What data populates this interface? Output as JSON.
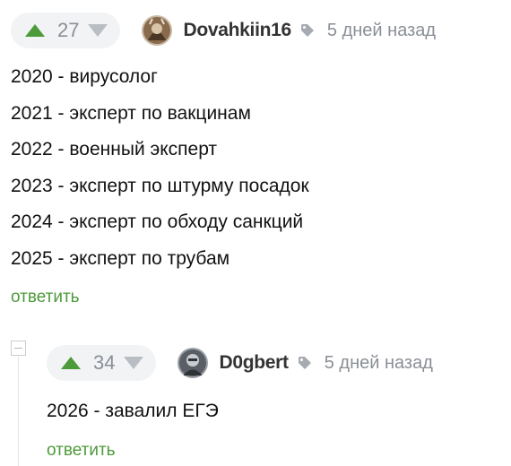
{
  "comments": [
    {
      "votes": "27",
      "username": "Dovahkiin16",
      "time": "5 дней назад",
      "lines": [
        "2020 - вирусолог",
        "2021 - эксперт по вакцинам",
        "2022 - военный эксперт",
        "2023 - эксперт по штурму посадок",
        "2024 - эксперт по обходу санкций",
        "2025 - эксперт по трубам"
      ],
      "reply_label": "ответить"
    },
    {
      "votes": "34",
      "username": "D0gbert",
      "time": "5 дней назад",
      "lines": [
        "2026 - завалил ЕГЭ"
      ],
      "reply_label": "ответить"
    }
  ],
  "colors": {
    "upvote": "#4d9a3a",
    "downvote": "#b9bec5",
    "reply": "#4d9a3a",
    "meta": "#8a8f96"
  },
  "icons": [
    "arrow-up-icon",
    "arrow-down-icon",
    "tag-icon",
    "collapse-icon"
  ]
}
